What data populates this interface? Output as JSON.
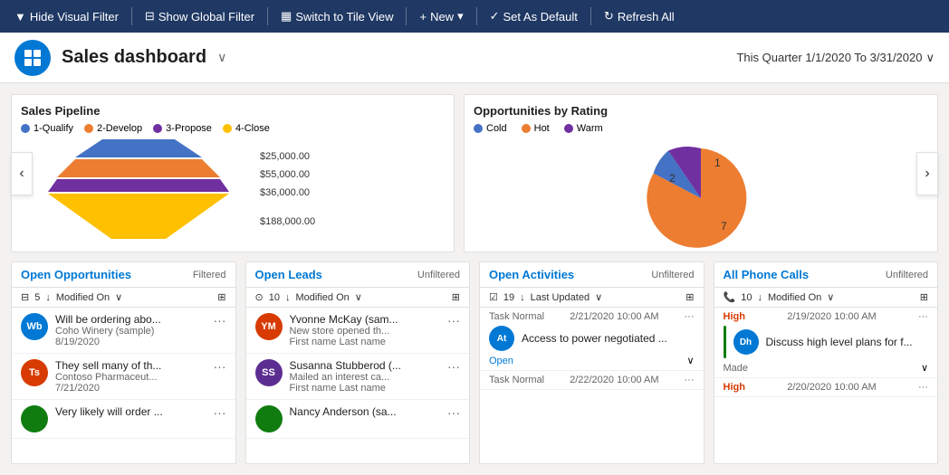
{
  "toolbar": {
    "hide_filter_label": "Hide Visual Filter",
    "show_global_filter_label": "Show Global Filter",
    "switch_tile_view_label": "Switch to Tile View",
    "new_label": "New",
    "set_default_label": "Set As Default",
    "refresh_all_label": "Refresh All"
  },
  "header": {
    "title": "Sales dashboard",
    "date_range": "This Quarter 1/1/2020 To 3/31/2020",
    "icon_text": "⊞"
  },
  "charts": {
    "pipeline": {
      "title": "Sales Pipeline",
      "legend": [
        {
          "label": "1-Qualify",
          "color": "#4472c4"
        },
        {
          "label": "2-Develop",
          "color": "#ed7d31"
        },
        {
          "label": "3-Propose",
          "color": "#7030a0"
        },
        {
          "label": "4-Close",
          "color": "#ffc000"
        }
      ],
      "values": [
        {
          "label": "$25,000.00",
          "color": "#4472c4"
        },
        {
          "label": "$55,000.00",
          "color": "#ed7d31"
        },
        {
          "label": "$36,000.00",
          "color": "#7030a0"
        },
        {
          "label": "$188,000.00",
          "color": "#ffc000"
        }
      ]
    },
    "rating": {
      "title": "Opportunities by Rating",
      "legend": [
        {
          "label": "Cold",
          "color": "#4472c4"
        },
        {
          "label": "Hot",
          "color": "#ed7d31"
        },
        {
          "label": "Warm",
          "color": "#7030a0"
        }
      ],
      "slices": [
        {
          "label": "1",
          "value": 1,
          "color": "#4472c4",
          "percent": 10
        },
        {
          "label": "2",
          "value": 2,
          "color": "#7030a0",
          "percent": 20
        },
        {
          "label": "7",
          "value": 7,
          "color": "#ed7d31",
          "percent": 70
        }
      ]
    }
  },
  "lists": {
    "open_opportunities": {
      "title": "Open Opportunities",
      "badge": "Filtered",
      "count": "5",
      "sort": "Modified On",
      "items": [
        {
          "avatar_text": "Wb",
          "avatar_color": "#0078d4",
          "name": "Will be ordering abo...",
          "sub": "Coho Winery (sample)",
          "date": "8/19/2020"
        },
        {
          "avatar_text": "Ts",
          "avatar_color": "#d83b01",
          "name": "They sell many of th...",
          "sub": "Contoso Pharmaceut...",
          "date": "7/21/2020"
        },
        {
          "avatar_text": "",
          "avatar_color": "#107c10",
          "name": "Very likely will order ...",
          "sub": "",
          "date": ""
        }
      ]
    },
    "open_leads": {
      "title": "Open Leads",
      "badge": "Unfiltered",
      "count": "10",
      "sort": "Modified On",
      "items": [
        {
          "avatar_text": "YM",
          "avatar_color": "#d83b01",
          "name": "Yvonne McKay (sam...",
          "sub": "New store opened th...",
          "sub2": "First name Last name"
        },
        {
          "avatar_text": "SS",
          "avatar_color": "#5c2d91",
          "name": "Susanna Stubberod (...",
          "sub": "Mailed an interest ca...",
          "sub2": "First name Last name"
        },
        {
          "avatar_text": "",
          "avatar_color": "#107c10",
          "name": "Nancy Anderson (sa...",
          "sub": "",
          "sub2": ""
        }
      ]
    },
    "open_activities": {
      "title": "Open Activities",
      "badge": "Unfiltered",
      "count": "19",
      "sort": "Last Updated",
      "items": [
        {
          "type": "Task  Normal",
          "time": "2/21/2020 10:00 AM",
          "avatar_text": "At",
          "avatar_color": "#0078d4",
          "title": "Access to power negotiated ...",
          "status": "Open"
        },
        {
          "type": "Task  Normal",
          "time": "2/22/2020 10:00 AM",
          "avatar_text": "",
          "avatar_color": "#666",
          "title": "",
          "status": ""
        }
      ]
    },
    "phone_calls": {
      "title": "All Phone Calls",
      "badge": "Unfiltered",
      "count": "10",
      "sort": "Modified On",
      "items": [
        {
          "priority": "High",
          "time": "2/19/2020 10:00 AM",
          "avatar_text": "Dh",
          "avatar_color": "#0078d4",
          "title": "Discuss high level plans for f...",
          "status": "Made",
          "bar_color": "#107c10"
        },
        {
          "priority": "High",
          "time": "2/20/2020 10:00 AM",
          "avatar_text": "",
          "avatar_color": "#666",
          "title": "",
          "status": "",
          "bar_color": "#0078d4"
        }
      ]
    }
  }
}
